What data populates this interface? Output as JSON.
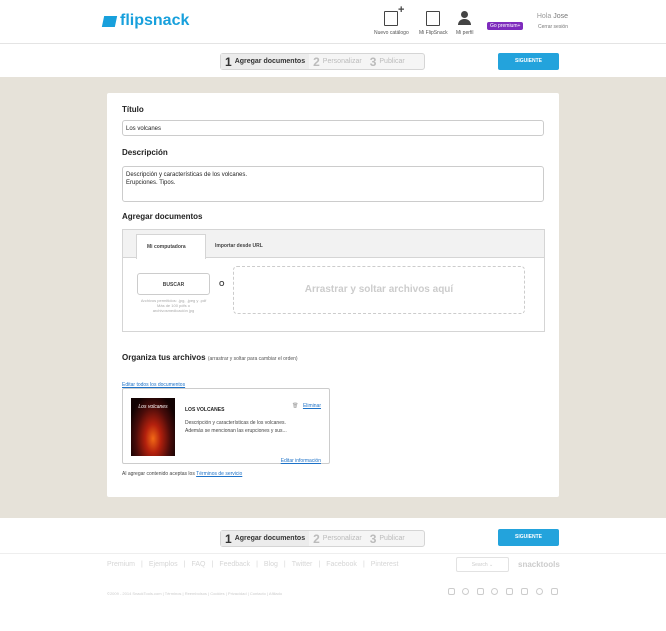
{
  "header": {
    "brand": "flipsnack",
    "nav": [
      {
        "label": "Nuevo catálogo",
        "icon": "new-catalog-icon"
      },
      {
        "label": "Mi FlipSnack",
        "icon": "flipsnack-icon"
      },
      {
        "label": "Mi perfil",
        "icon": "profile-icon"
      }
    ],
    "premium_badge": "Go premium+",
    "greeting_prefix": "Hola",
    "user_name": "Jose",
    "logout": "Cerrar sesión"
  },
  "steps": {
    "items": [
      {
        "num": "1",
        "label": "Agregar documentos"
      },
      {
        "num": "2",
        "label": "Personalizar"
      },
      {
        "num": "3",
        "label": "Publicar"
      }
    ],
    "next_button": "SIGUIENTE"
  },
  "form": {
    "title_label": "Título",
    "title_value": "Los volcanes",
    "description_label": "Descripción",
    "description_line1": "Descripción y características de los volcanes.",
    "description_line2": "Erupciones. Tipos.",
    "add_docs_label": "Agregar documentos",
    "tabs": [
      "Mi computadora",
      "Importar desde URL"
    ],
    "browse_button": "BUSCAR",
    "file_hint_line1": "Archivos permitidos: .jpg, .jpeg y .pdf",
    "file_hint_line2": "Más de 100 pdfs o",
    "file_hint_line3": "archivosmedicación jpg",
    "or_text": "O",
    "drop_zone": "Arrastrar y soltar archivos aquí"
  },
  "organize": {
    "heading": "Organiza tus archivos",
    "heading_hint": "(arrastrar y soltar para cambiar el orden)",
    "edit_all_link": "Editar todos los documentos",
    "document": {
      "thumb_title": "Los volcanes",
      "title": "LOS VOLCANES",
      "description_line1": "Descripción y características de los volcanes.",
      "description_line2": "Además se mencionan las erupciones y sus...",
      "delete_link": "Eliminar",
      "edit_link": "Editar información"
    },
    "terms_prefix": "Al agregar contenido aceptas los",
    "terms_link": "Términos de servicio"
  },
  "footer": {
    "links": [
      "Premium",
      "Ejemplos",
      "FAQ",
      "Feedback",
      "Blog",
      "Twitter",
      "Facebook",
      "Pinterest"
    ],
    "search_placeholder": "Search",
    "brand": "snacktools",
    "copyright": "©2009 - 2014 SnackTools.com",
    "legal_links": [
      "Términos",
      "Reembolsos",
      "Cookies",
      "Privacidad",
      "Contacto",
      "Afiliado"
    ]
  },
  "colors": {
    "accent": "#23a3dc",
    "brand": "#18a0dc",
    "stage_bg": "#e6e2d9",
    "premium": "#7e2bbd",
    "link": "#1d72c8"
  }
}
